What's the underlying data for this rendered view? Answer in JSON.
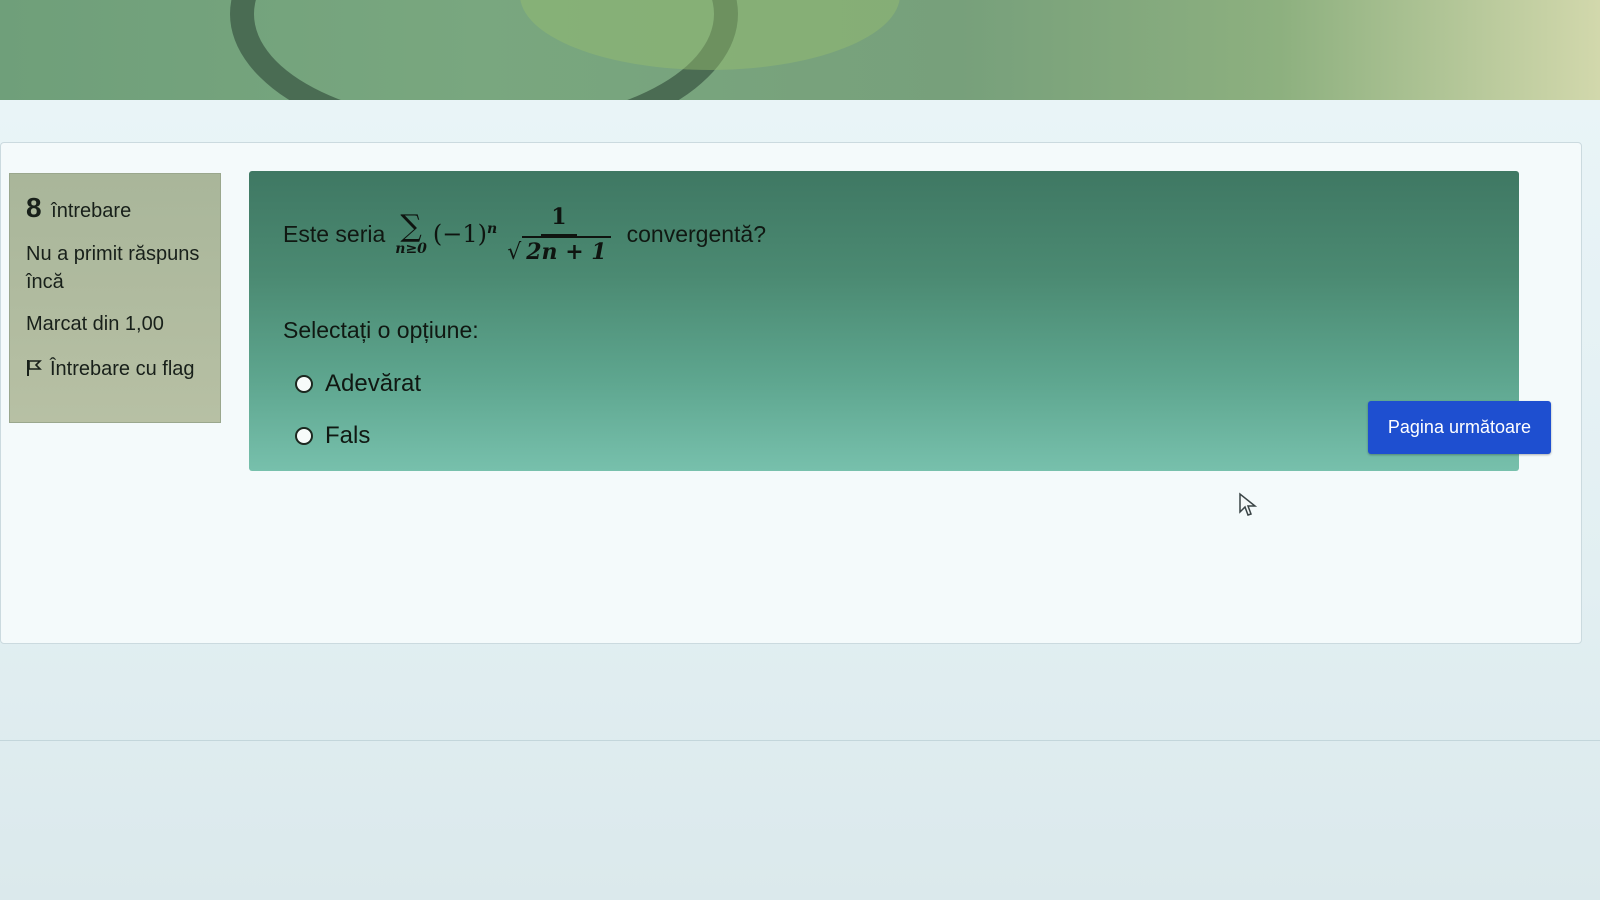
{
  "question_info": {
    "number": "8",
    "label": "întrebare",
    "status": "Nu a primit răspuns încă",
    "marks": "Marcat din 1,00",
    "flag_label": "Întrebare cu flag"
  },
  "question": {
    "prefix": "Este seria",
    "formula": {
      "sigma": "∑",
      "subscript": "n≥0",
      "base": "(−1)",
      "exponent": "n",
      "numerator": "1",
      "radical": "√",
      "radicand": "2n + 1"
    },
    "suffix": "convergentă?",
    "select_prompt": "Selectați o opțiune:",
    "options": [
      {
        "label": "Adevărat",
        "selected": false
      },
      {
        "label": "Fals",
        "selected": false
      }
    ]
  },
  "navigation": {
    "next_button": "Pagina următoare"
  },
  "colors": {
    "question_bg": "#4b8a72",
    "info_bg": "#b0bb9f",
    "button_bg": "#1e4fd0"
  }
}
